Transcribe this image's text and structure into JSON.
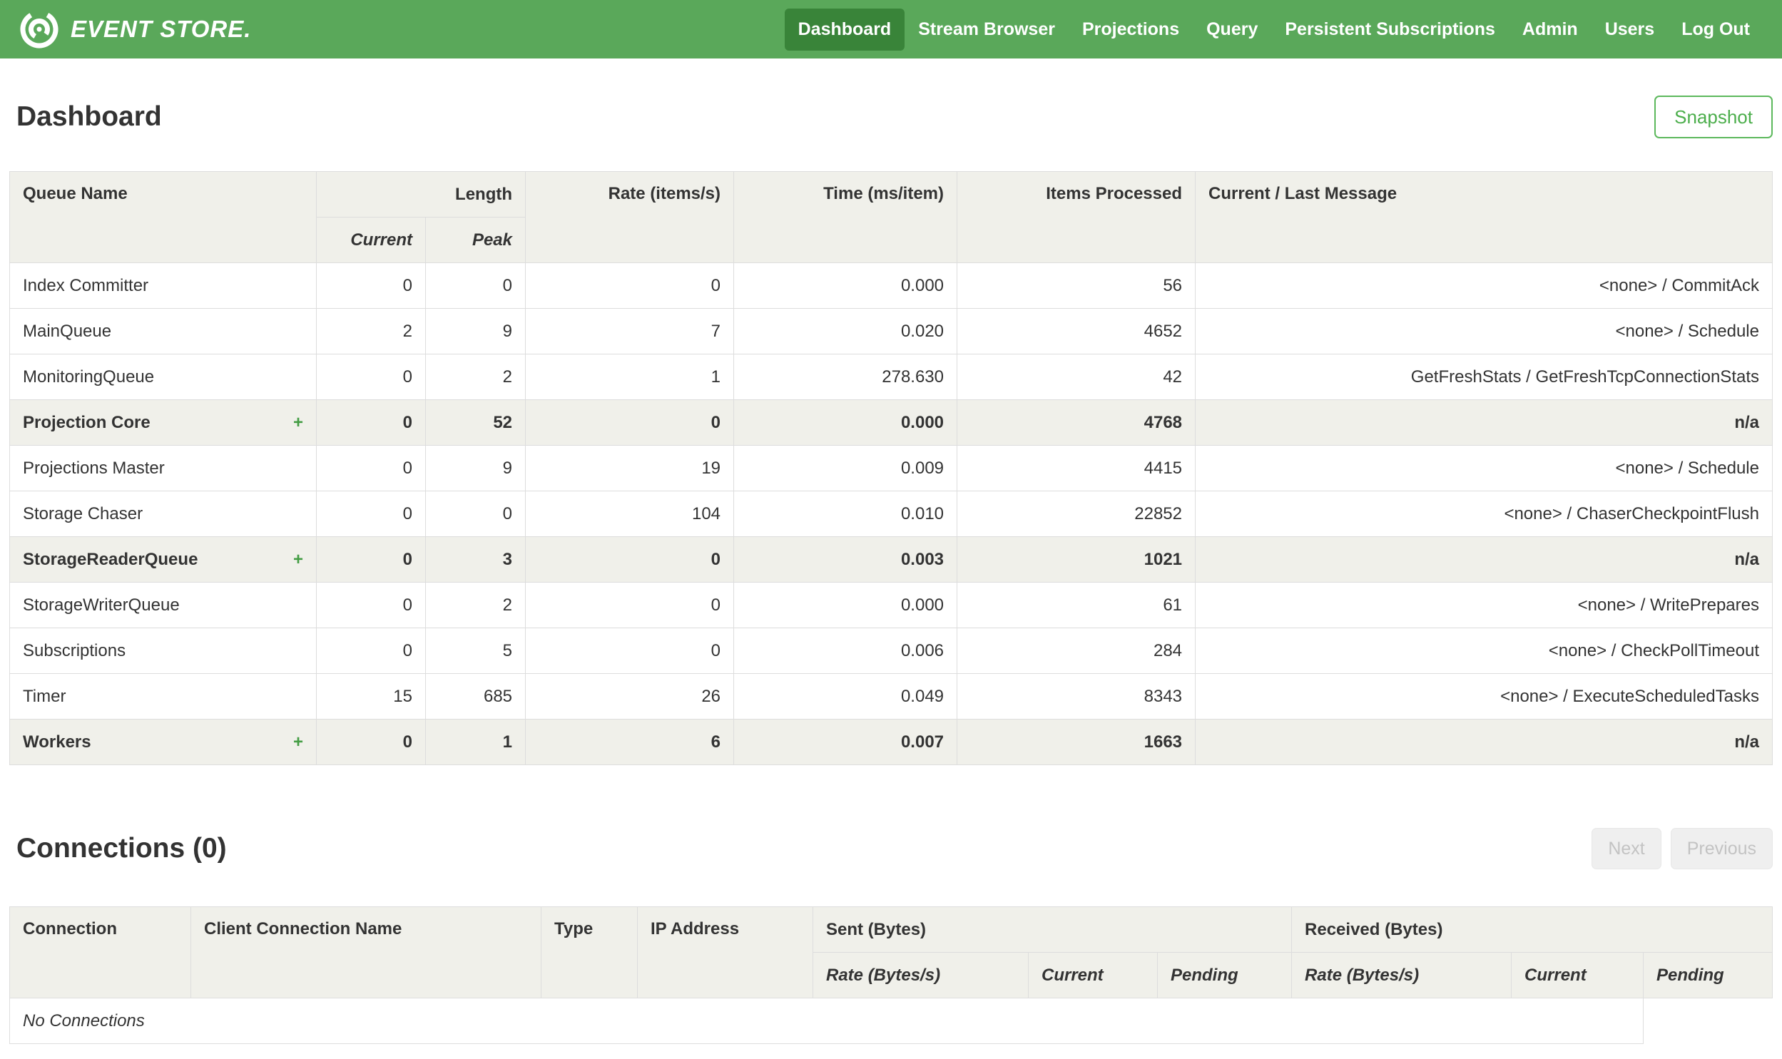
{
  "colors": {
    "navbar_green": "#5aa85a",
    "active_nav_green": "#398439",
    "accent_green": "#4cae4c",
    "header_bg": "#f0f0ea"
  },
  "icons": {
    "expand": "+"
  },
  "navbar": {
    "logo_text": "EVENT STORE.",
    "items": [
      {
        "label": "Dashboard",
        "active": true
      },
      {
        "label": "Stream Browser"
      },
      {
        "label": "Projections"
      },
      {
        "label": "Query"
      },
      {
        "label": "Persistent Subscriptions"
      },
      {
        "label": "Admin"
      },
      {
        "label": "Users"
      },
      {
        "label": "Log Out"
      }
    ]
  },
  "page": {
    "title": "Dashboard",
    "snapshot_button": "Snapshot"
  },
  "queues_table": {
    "headers": {
      "queue_name": "Queue Name",
      "length": "Length",
      "length_current": "Current",
      "length_peak": "Peak",
      "rate": "Rate (items/s)",
      "time": "Time (ms/item)",
      "items_processed": "Items Processed",
      "message": "Current / Last Message"
    },
    "rows": [
      {
        "name": "Index Committer",
        "expandable": false,
        "current": "0",
        "peak": "0",
        "rate": "0",
        "time": "0.000",
        "items": "56",
        "message": "<none> / CommitAck"
      },
      {
        "name": "MainQueue",
        "expandable": false,
        "current": "2",
        "peak": "9",
        "rate": "7",
        "time": "0.020",
        "items": "4652",
        "message": "<none> / Schedule"
      },
      {
        "name": "MonitoringQueue",
        "expandable": false,
        "current": "0",
        "peak": "2",
        "rate": "1",
        "time": "278.630",
        "items": "42",
        "message": "GetFreshStats / GetFreshTcpConnectionStats"
      },
      {
        "name": "Projection Core",
        "expandable": true,
        "current": "0",
        "peak": "52",
        "rate": "0",
        "time": "0.000",
        "items": "4768",
        "message": "n/a"
      },
      {
        "name": "Projections Master",
        "expandable": false,
        "current": "0",
        "peak": "9",
        "rate": "19",
        "time": "0.009",
        "items": "4415",
        "message": "<none> / Schedule"
      },
      {
        "name": "Storage Chaser",
        "expandable": false,
        "current": "0",
        "peak": "0",
        "rate": "104",
        "time": "0.010",
        "items": "22852",
        "message": "<none> / ChaserCheckpointFlush"
      },
      {
        "name": "StorageReaderQueue",
        "expandable": true,
        "current": "0",
        "peak": "3",
        "rate": "0",
        "time": "0.003",
        "items": "1021",
        "message": "n/a"
      },
      {
        "name": "StorageWriterQueue",
        "expandable": false,
        "current": "0",
        "peak": "2",
        "rate": "0",
        "time": "0.000",
        "items": "61",
        "message": "<none> / WritePrepares"
      },
      {
        "name": "Subscriptions",
        "expandable": false,
        "current": "0",
        "peak": "5",
        "rate": "0",
        "time": "0.006",
        "items": "284",
        "message": "<none> / CheckPollTimeout"
      },
      {
        "name": "Timer",
        "expandable": false,
        "current": "15",
        "peak": "685",
        "rate": "26",
        "time": "0.049",
        "items": "8343",
        "message": "<none> / ExecuteScheduledTasks"
      },
      {
        "name": "Workers",
        "expandable": true,
        "current": "0",
        "peak": "1",
        "rate": "6",
        "time": "0.007",
        "items": "1663",
        "message": "n/a"
      }
    ]
  },
  "connections": {
    "title": "Connections (0)",
    "next_button": "Next",
    "previous_button": "Previous",
    "headers": {
      "connection": "Connection",
      "client_name": "Client Connection Name",
      "type": "Type",
      "ip": "IP Address",
      "sent": "Sent (Bytes)",
      "received": "Received (Bytes)",
      "rate": "Rate (Bytes/s)",
      "current": "Current",
      "pending": "Pending"
    },
    "empty_text": "No Connections"
  }
}
